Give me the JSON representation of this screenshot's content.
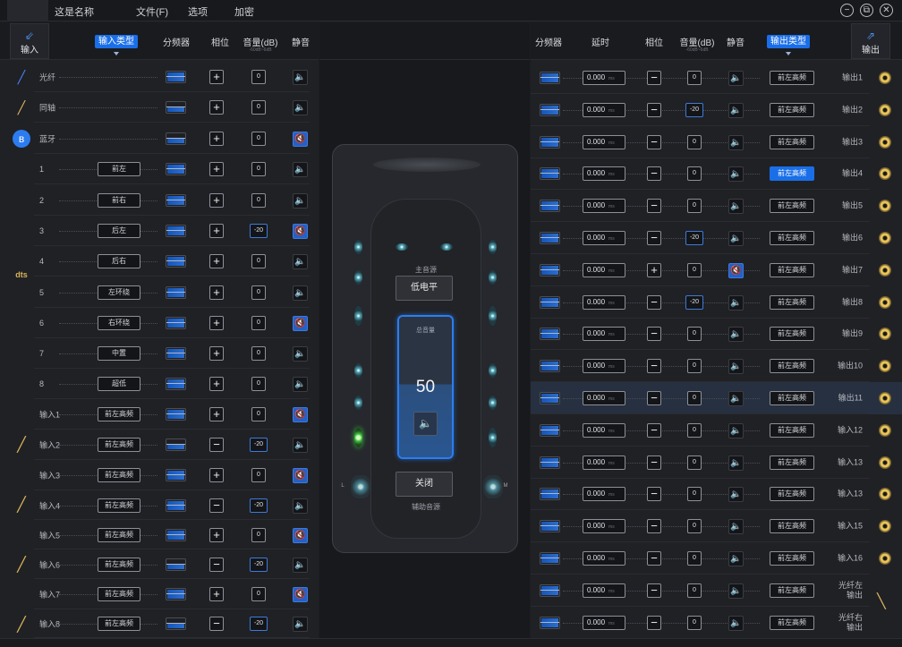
{
  "app": {
    "title": "这是名称",
    "menus": [
      "文件(F)",
      "选项",
      "加密"
    ]
  },
  "window": {
    "minimize": "−",
    "maximize": "⧉",
    "close": "✕"
  },
  "left_header": {
    "input_button": "输入",
    "input_type": "输入类型",
    "crossover": "分频器",
    "phase": "相位",
    "volume": "音量(dB)",
    "volume_range": "-60dB~6dB",
    "mute": "静音"
  },
  "right_header": {
    "crossover": "分频器",
    "delay": "延时",
    "phase": "相位",
    "volume": "音量(dB)",
    "volume_range": "-60dB~6dB",
    "mute": "静音",
    "output_type": "输出类型",
    "output_button": "输出"
  },
  "inputs": [
    {
      "label": "光纤",
      "type": "",
      "phase": "+",
      "vol": "0",
      "mute": false,
      "icon": "fiber-icon"
    },
    {
      "label": "同轴",
      "type": "",
      "phase": "+",
      "vol": "0",
      "mute": false,
      "icon": "coax-plug-icon"
    },
    {
      "label": "蓝牙",
      "type": "",
      "phase": "+",
      "vol": "0",
      "mute": true,
      "icon": "bluetooth-icon"
    },
    {
      "label": "1",
      "type": "前左",
      "phase": "+",
      "vol": "0",
      "mute": false,
      "icon": ""
    },
    {
      "label": "2",
      "type": "前右",
      "phase": "+",
      "vol": "0",
      "mute": false,
      "icon": ""
    },
    {
      "label": "3",
      "type": "后左",
      "phase": "+",
      "vol": "-20",
      "mute": true,
      "icon": ""
    },
    {
      "label": "4",
      "type": "后右",
      "phase": "+",
      "vol": "0",
      "mute": false,
      "icon": ""
    },
    {
      "label": "5",
      "type": "左环绕",
      "phase": "+",
      "vol": "0",
      "mute": false,
      "icon": ""
    },
    {
      "label": "6",
      "type": "右环绕",
      "phase": "+",
      "vol": "0",
      "mute": true,
      "icon": ""
    },
    {
      "label": "7",
      "type": "中置",
      "phase": "+",
      "vol": "0",
      "mute": false,
      "icon": ""
    },
    {
      "label": "8",
      "type": "超低",
      "phase": "+",
      "vol": "0",
      "mute": false,
      "icon": ""
    },
    {
      "label": "输入1",
      "type": "前左高频",
      "phase": "+",
      "vol": "0",
      "mute": true,
      "icon": ""
    },
    {
      "label": "输入2",
      "type": "前左高频",
      "phase": "−",
      "vol": "-20",
      "mute": false,
      "icon": ""
    },
    {
      "label": "输入3",
      "type": "前左高频",
      "phase": "+",
      "vol": "0",
      "mute": true,
      "icon": ""
    },
    {
      "label": "输入4",
      "type": "前左高频",
      "phase": "−",
      "vol": "-20",
      "mute": false,
      "icon": ""
    },
    {
      "label": "输入5",
      "type": "前左高频",
      "phase": "+",
      "vol": "0",
      "mute": true,
      "icon": ""
    },
    {
      "label": "输入6",
      "type": "前左高频",
      "phase": "−",
      "vol": "-20",
      "mute": false,
      "icon": ""
    },
    {
      "label": "输入7",
      "type": "前左高频",
      "phase": "+",
      "vol": "0",
      "mute": true,
      "icon": ""
    },
    {
      "label": "输入8",
      "type": "前左高频",
      "phase": "−",
      "vol": "-20",
      "mute": false,
      "icon": ""
    }
  ],
  "dts_logo": "dts",
  "outputs": [
    {
      "label": "输出1",
      "delay": "0.000",
      "unit": "ms",
      "phase": "−",
      "vol": "0",
      "mute": false,
      "type": "前左高频",
      "selected": false
    },
    {
      "label": "输出2",
      "delay": "0.000",
      "unit": "ms",
      "phase": "−",
      "vol": "-20",
      "mute": false,
      "type": "前左高频",
      "selected": false
    },
    {
      "label": "输出3",
      "delay": "0.000",
      "unit": "ms",
      "phase": "−",
      "vol": "0",
      "mute": false,
      "type": "前左高频",
      "selected": false
    },
    {
      "label": "输出4",
      "delay": "0.000",
      "unit": "ms",
      "phase": "−",
      "vol": "0",
      "mute": false,
      "type": "前左高频",
      "selected": true
    },
    {
      "label": "输出5",
      "delay": "0.000",
      "unit": "ms",
      "phase": "−",
      "vol": "0",
      "mute": false,
      "type": "前左高频",
      "selected": false
    },
    {
      "label": "输出6",
      "delay": "0.000",
      "unit": "ms",
      "phase": "−",
      "vol": "-20",
      "mute": false,
      "type": "前左高频",
      "selected": false
    },
    {
      "label": "输出7",
      "delay": "0.000",
      "unit": "ms",
      "phase": "+",
      "vol": "0",
      "mute": true,
      "type": "前左高频",
      "selected": false
    },
    {
      "label": "输出8",
      "delay": "0.000",
      "unit": "ms",
      "phase": "−",
      "vol": "-20",
      "mute": false,
      "type": "前左高频",
      "selected": false
    },
    {
      "label": "输出9",
      "delay": "0.000",
      "unit": "ms",
      "phase": "−",
      "vol": "0",
      "mute": false,
      "type": "前左高频",
      "selected": false
    },
    {
      "label": "输出10",
      "delay": "0.000",
      "unit": "ms",
      "phase": "−",
      "vol": "0",
      "mute": false,
      "type": "前左高频",
      "selected": false
    },
    {
      "label": "输出11",
      "delay": "0.000",
      "unit": "ms",
      "phase": "−",
      "vol": "0",
      "mute": false,
      "type": "前左高频",
      "selected": false,
      "highlight": true
    },
    {
      "label": "输入12",
      "delay": "0.000",
      "unit": "ms",
      "phase": "−",
      "vol": "0",
      "mute": false,
      "type": "前左高频",
      "selected": false
    },
    {
      "label": "输入13",
      "delay": "0.000",
      "unit": "ms",
      "phase": "−",
      "vol": "0",
      "mute": false,
      "type": "前左高频",
      "selected": false
    },
    {
      "label": "输入13",
      "delay": "0.000",
      "unit": "ms",
      "phase": "−",
      "vol": "0",
      "mute": false,
      "type": "前左高频",
      "selected": false
    },
    {
      "label": "输入15",
      "delay": "0.000",
      "unit": "ms",
      "phase": "−",
      "vol": "0",
      "mute": false,
      "type": "前左高频",
      "selected": false
    },
    {
      "label": "输入16",
      "delay": "0.000",
      "unit": "ms",
      "phase": "−",
      "vol": "0",
      "mute": false,
      "type": "前左高频",
      "selected": false
    },
    {
      "label": "光纤左\n输出",
      "delay": "0.000",
      "unit": "ms",
      "phase": "−",
      "vol": "0",
      "mute": false,
      "type": "前左高频",
      "selected": false
    },
    {
      "label": "光纤右\n输出",
      "delay": "0.000",
      "unit": "ms",
      "phase": "−",
      "vol": "0",
      "mute": false,
      "type": "前左高频",
      "selected": false
    }
  ],
  "center": {
    "main_source": "主音源",
    "low_level": "低电平",
    "master_volume_label": "总音量",
    "master_volume": "50",
    "close": "关闭",
    "aux_source": "辅助音源",
    "left_mark": "L",
    "right_mark": "M"
  }
}
